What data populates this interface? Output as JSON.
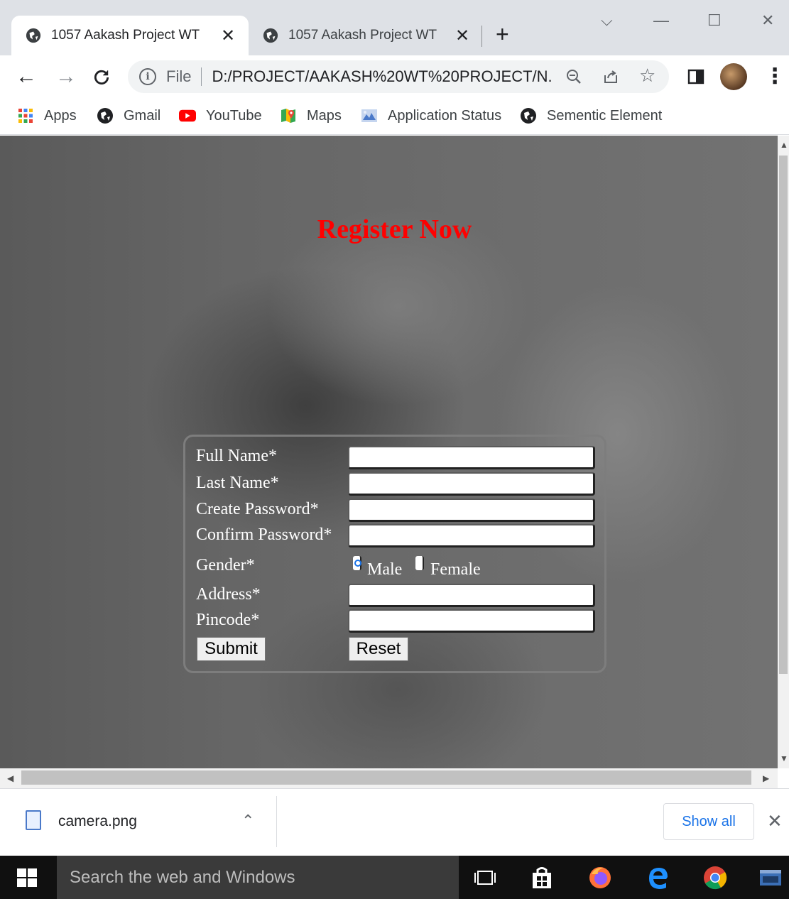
{
  "browser": {
    "tabs": [
      {
        "title": "1057 Aakash Project WT",
        "close": "✕"
      },
      {
        "title": "1057 Aakash Project WT",
        "close": "✕"
      }
    ],
    "new_tab": "+",
    "window_controls": {
      "dropdown": "⌵",
      "minimize": "—",
      "maximize": "☐",
      "close": "✕"
    },
    "nav": {
      "back": "←",
      "forward": "→",
      "reload": "C"
    },
    "omnibox": {
      "info": "i",
      "scheme": "File",
      "url": "D:/PROJECT/AAKASH%20WT%20PROJECT/N..."
    },
    "omni_icons": {
      "zoom": "⚲",
      "share": "⇪",
      "bookmark": "☆"
    },
    "menu": "⋮"
  },
  "bookmarks": [
    {
      "label": "Apps",
      "icon": "apps-grid-icon"
    },
    {
      "label": "Gmail",
      "icon": "globe-icon"
    },
    {
      "label": "YouTube",
      "icon": "youtube-icon"
    },
    {
      "label": "Maps",
      "icon": "maps-icon"
    },
    {
      "label": "Application Status",
      "icon": "application-status-icon"
    },
    {
      "label": "Sementic Element",
      "icon": "globe-icon"
    }
  ],
  "page": {
    "heading": "Register Now",
    "form": {
      "full_name_label": "Full Name*",
      "last_name_label": "Last Name*",
      "create_password_label": "Create Password*",
      "confirm_password_label": "Confirm Password*",
      "gender_label": "Gender*",
      "gender_options": [
        "Male",
        "Female"
      ],
      "gender_selected": "Male",
      "address_label": "Address*",
      "pincode_label": "Pincode*",
      "submit_label": "Submit",
      "reset_label": "Reset"
    }
  },
  "downloads": {
    "file_name": "camera.png",
    "chevron": "⌃",
    "show_all": "Show all",
    "close": "✕"
  },
  "taskbar": {
    "search_placeholder": "Search the web and Windows"
  },
  "colors": {
    "heading": "#ff0000",
    "accent": "#1a73e8",
    "tab_strip": "#dee1e6"
  }
}
